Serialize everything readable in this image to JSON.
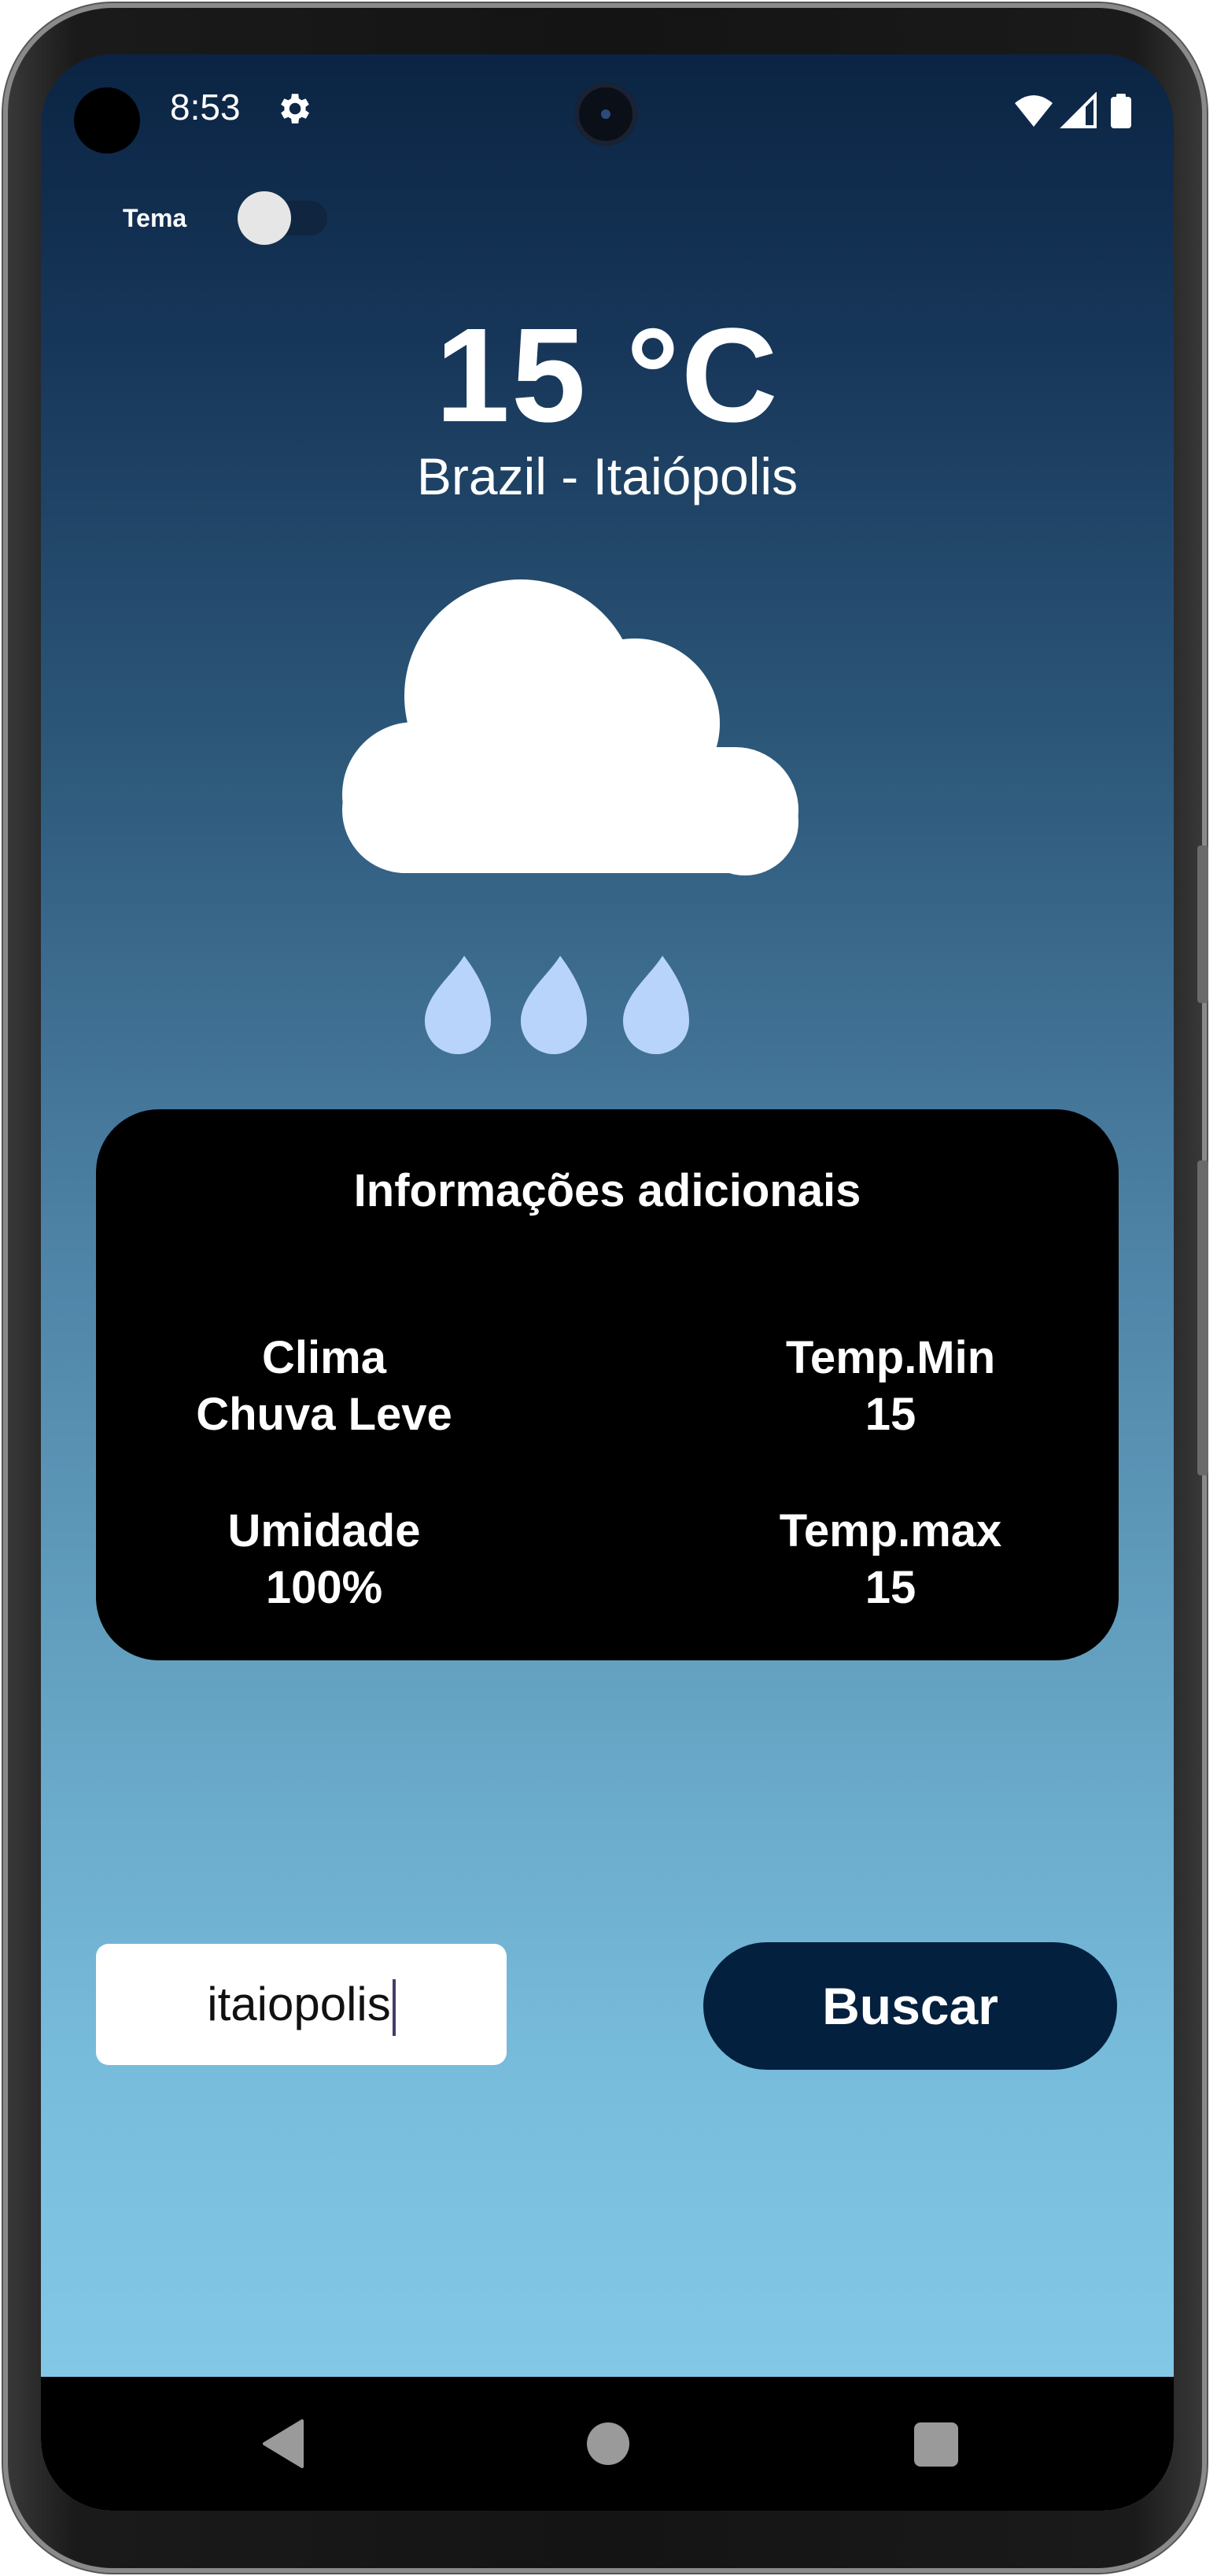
{
  "status_bar": {
    "time": "8:53",
    "settings_icon": "gear-icon",
    "icons": [
      "wifi-icon",
      "signal-icon",
      "battery-icon"
    ]
  },
  "theme": {
    "label": "Tema",
    "toggle_on": false
  },
  "weather": {
    "temperature": "15 °C",
    "location": "Brazil - Itaiópolis",
    "icon": "rain-cloud-icon"
  },
  "info_card": {
    "title": "Informações adicionais",
    "clima_label": "Clima",
    "clima_value": "Chuva Leve",
    "temp_min_label": "Temp.Min",
    "temp_min_value": "15",
    "umidade_label": "Umidade",
    "umidade_value": "100%",
    "temp_max_label": "Temp.max",
    "temp_max_value": "15"
  },
  "search": {
    "value": "itaiopolis",
    "button_label": "Buscar"
  },
  "colors": {
    "button_bg": "#03203f",
    "card_bg": "#000000",
    "rain_drop": "#b9d4fb"
  },
  "nav": {
    "items": [
      "back-icon",
      "home-icon",
      "recents-icon"
    ]
  }
}
